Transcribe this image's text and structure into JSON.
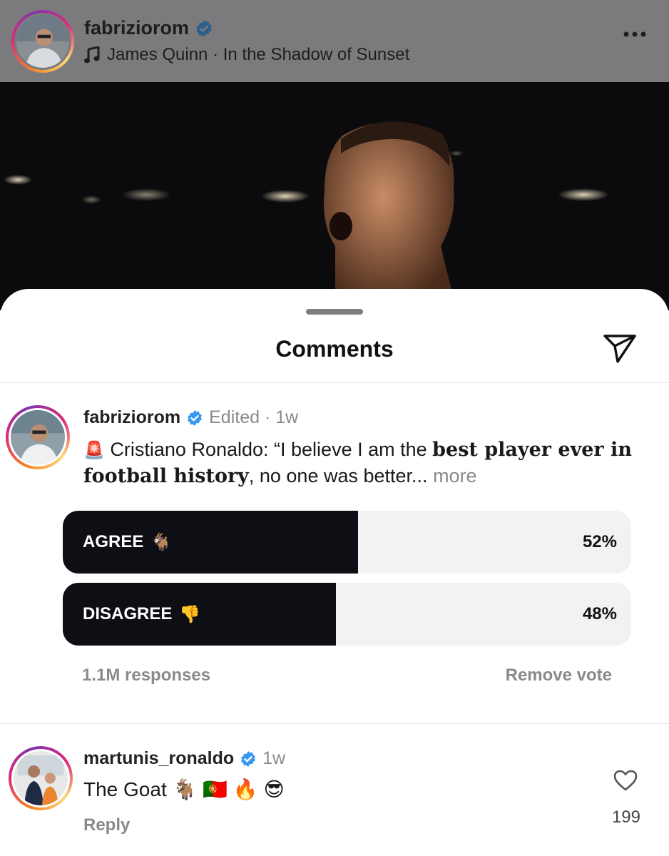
{
  "post": {
    "username": "fabriziorom",
    "verified": true,
    "music": "James Quinn · In the Shadow of Sunset"
  },
  "comments_sheet": {
    "title": "Comments"
  },
  "pinned_comment": {
    "username": "fabriziorom",
    "meta": "Edited · 1w",
    "emoji": "🚨",
    "text_before": "Cristiano Ronaldo: “I believe I am the ",
    "text_bold": "best player ever in football history",
    "text_after": ", no one was better...",
    "more_label": "more"
  },
  "poll": {
    "options": [
      {
        "label": "AGREE",
        "emoji": "🐐",
        "percent_label": "52%",
        "percent": 52
      },
      {
        "label": "DISAGREE",
        "emoji": "👎",
        "percent_label": "48%",
        "percent": 48
      }
    ],
    "responses": "1.1M responses",
    "remove_vote": "Remove vote"
  },
  "reply_comment": {
    "username": "martunis_ronaldo",
    "meta": "1w",
    "text": "The Goat 🐐 🇵🇹 🔥 😎",
    "likes": "199",
    "reply_label": "Reply"
  },
  "colors": {
    "verified": "#3897f0",
    "poll_fill": "#0e0f14",
    "poll_track": "#f2f2f3",
    "muted_text": "#8a8a8a"
  }
}
